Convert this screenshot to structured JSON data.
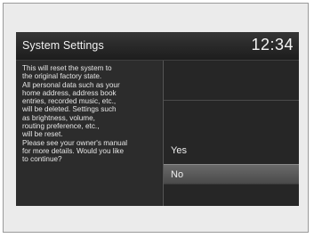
{
  "header": {
    "title": "System Settings",
    "clock": "12:34"
  },
  "dialog": {
    "message": "This will reset the system to\nthe original factory state.\nAll personal data such as your\nhome address, address book\nentries, recorded music, etc.,\nwill be deleted. Settings such\nas brightness, volume,\nrouting preference, etc.,\nwill be reset.\nPlease see your owner's manual\nfor more details. Would you like\nto continue?",
    "options": [
      {
        "label": "Yes",
        "selected": false
      },
      {
        "label": "No",
        "selected": true
      }
    ]
  },
  "colors": {
    "screen_background": "#2a2a2a",
    "selected_option": "#5a5a5a",
    "text": "#f2f2f2"
  }
}
